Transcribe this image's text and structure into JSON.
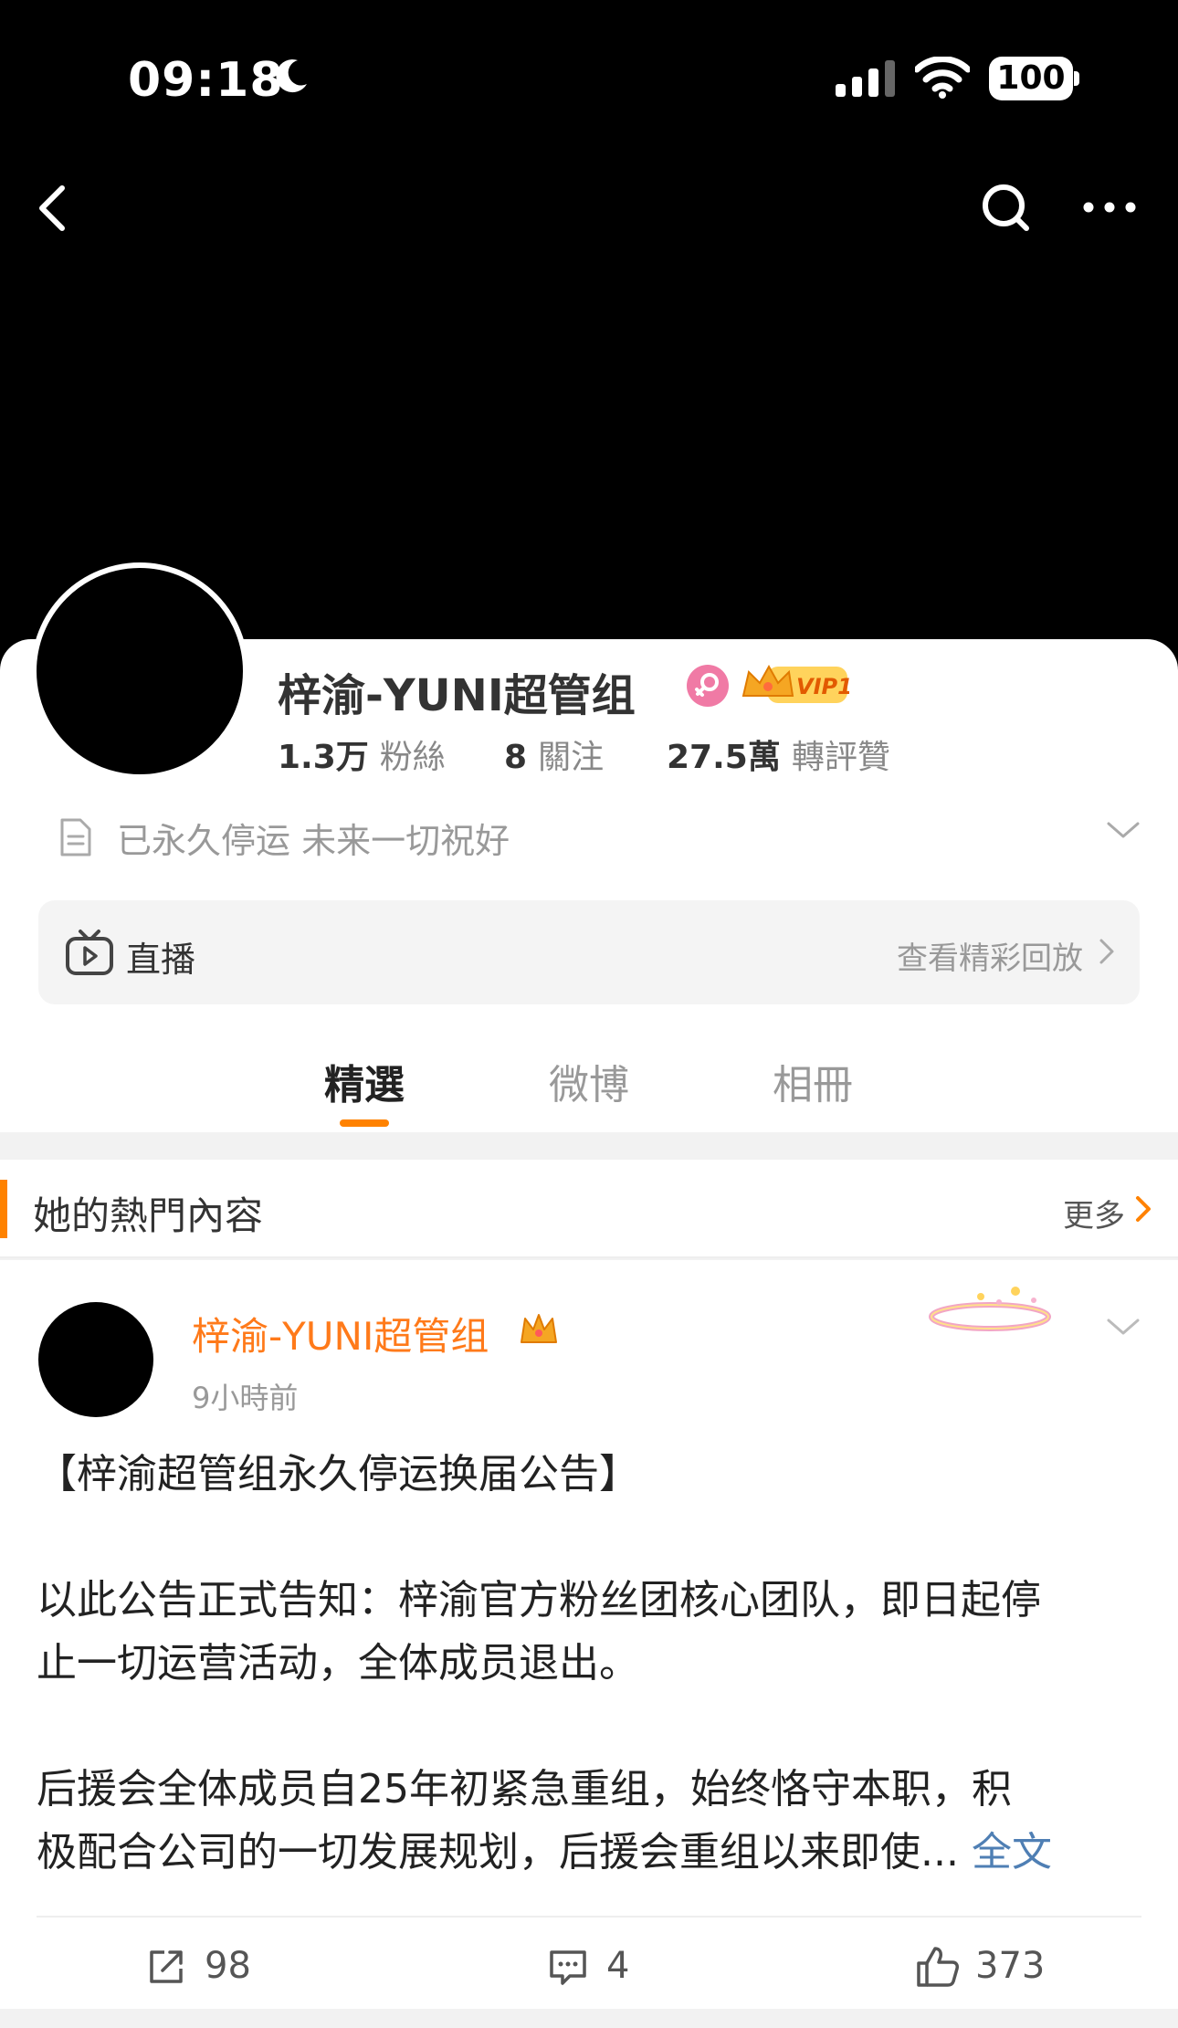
{
  "status_bar": {
    "time": "09:18",
    "battery": "100"
  },
  "profile": {
    "name": "梓渝-YUNI超管组",
    "vip_label": "VIP1",
    "stats": [
      {
        "num": "1.3万",
        "label": "粉絲"
      },
      {
        "num": "8",
        "label": "關注"
      },
      {
        "num": "27.5萬",
        "label": "轉評贊"
      }
    ],
    "bio": "已永久停运 未来一切祝好"
  },
  "live": {
    "label": "直播",
    "link": "查看精彩回放"
  },
  "tabs": [
    "精選",
    "微博",
    "相冊"
  ],
  "section": {
    "title": "她的熱門內容",
    "more": "更多"
  },
  "post": {
    "author": "梓渝-YUNI超管组",
    "time": "9小時前",
    "lines": [
      "【梓渝超管组永久停运换届公告】",
      "",
      "以此公告正式告知：梓渝官方粉丝团核心团队，即日起停",
      "止一切运营活动，全体成员退出。",
      "",
      "后援会全体成员自25年初紧急重组，始终恪守本职，积"
    ],
    "last_line": "极配合公司的一切发展规划，后援会重组以来即使...",
    "full_text_label": "全文",
    "reposts": "98",
    "comments": "4",
    "likes": "373"
  },
  "colors": {
    "accent": "#ff8200",
    "author": "#ff7a1a",
    "link": "#4f7fb4"
  }
}
